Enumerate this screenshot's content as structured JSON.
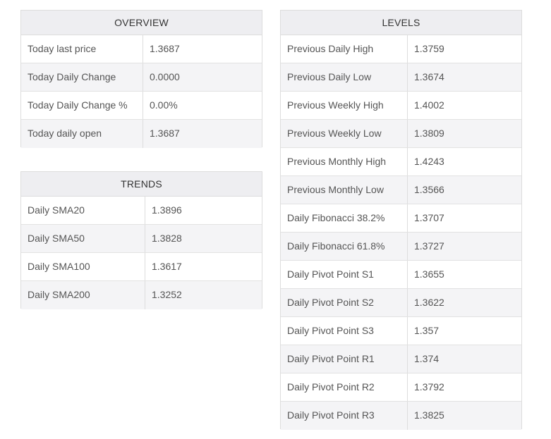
{
  "overview": {
    "title": "OVERVIEW",
    "rows": [
      {
        "label": "Today last price",
        "value": "1.3687"
      },
      {
        "label": "Today Daily Change",
        "value": "0.0000"
      },
      {
        "label": "Today Daily Change %",
        "value": "0.00%"
      },
      {
        "label": "Today daily open",
        "value": "1.3687"
      }
    ]
  },
  "trends": {
    "title": "TRENDS",
    "rows": [
      {
        "label": "Daily SMA20",
        "value": "1.3896"
      },
      {
        "label": "Daily SMA50",
        "value": "1.3828"
      },
      {
        "label": "Daily SMA100",
        "value": "1.3617"
      },
      {
        "label": "Daily SMA200",
        "value": "1.3252"
      }
    ]
  },
  "levels": {
    "title": "LEVELS",
    "rows": [
      {
        "label": "Previous Daily High",
        "value": "1.3759"
      },
      {
        "label": "Previous Daily Low",
        "value": "1.3674"
      },
      {
        "label": "Previous Weekly High",
        "value": "1.4002"
      },
      {
        "label": "Previous Weekly Low",
        "value": "1.3809"
      },
      {
        "label": "Previous Monthly High",
        "value": "1.4243"
      },
      {
        "label": "Previous Monthly Low",
        "value": "1.3566"
      },
      {
        "label": "Daily Fibonacci 38.2%",
        "value": "1.3707"
      },
      {
        "label": "Daily Fibonacci 61.8%",
        "value": "1.3727"
      },
      {
        "label": "Daily Pivot Point S1",
        "value": "1.3655"
      },
      {
        "label": "Daily Pivot Point S2",
        "value": "1.3622"
      },
      {
        "label": "Daily Pivot Point S3",
        "value": "1.357"
      },
      {
        "label": "Daily Pivot Point R1",
        "value": "1.374"
      },
      {
        "label": "Daily Pivot Point R2",
        "value": "1.3792"
      },
      {
        "label": "Daily Pivot Point R3",
        "value": "1.3825"
      }
    ]
  }
}
